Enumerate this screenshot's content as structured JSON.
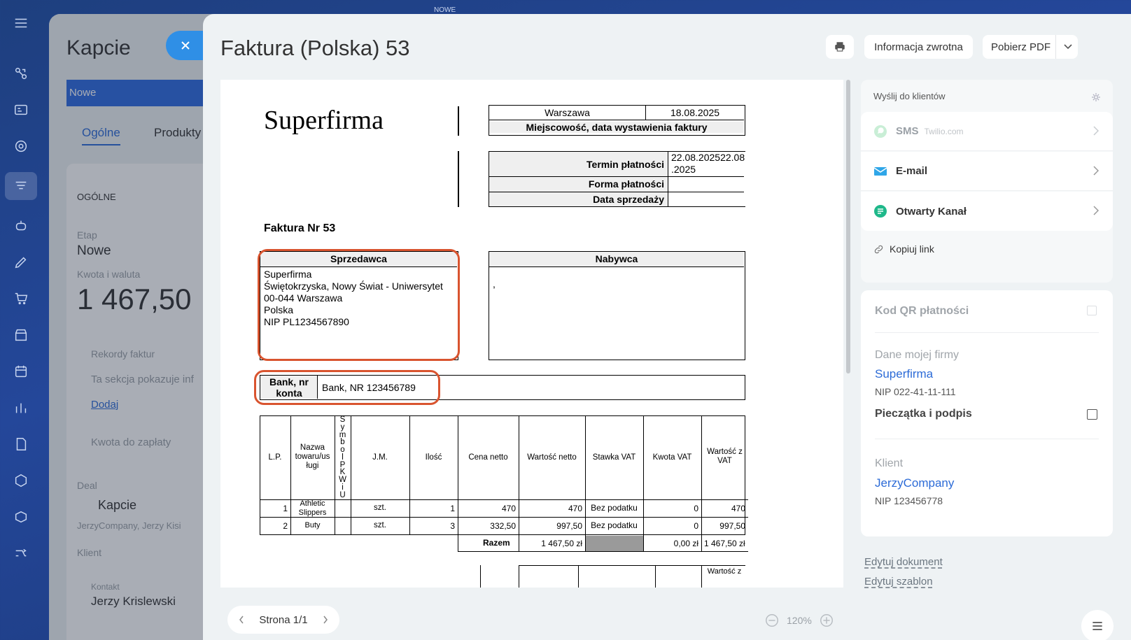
{
  "background": {
    "title": "Kapcie",
    "stage_bar": "Nowe",
    "tab_general": "Ogólne",
    "tab_products": "Produkty",
    "section": "OGÓLNE",
    "stage_label": "Etap",
    "stage_value": "Nowe",
    "amount_label": "Kwota i waluta",
    "amount_value": "1 467,50",
    "invoices_label": "Rekordy faktur",
    "invoices_info": "Ta sekcja pokazuje inf",
    "add_link": "Dodaj",
    "to_pay_label": "Kwota do zapłaty",
    "deal_label": "Deal",
    "deal_value": "Kapcie",
    "deal_sub": "JerzyCompany, Jerzy Kisi",
    "client_label": "Klient",
    "contact_label": "Kontakt",
    "contact_value": "Jerzy Krislewski",
    "top_badge": "NOWE"
  },
  "header": {
    "title": "Faktura (Polska) 53",
    "feedback": "Informacja zwrotna",
    "download_pdf": "Pobierz PDF"
  },
  "invoice": {
    "company": "Superfirma",
    "city": "Warszawa",
    "date": "18.08.2025",
    "place_date_label": "Miejscowość, data wystawienia faktury",
    "due_label": "Termin płatności",
    "due_value_1": "22.08.202522.08",
    "due_value_2": ".2025",
    "payment_form_label": "Forma płatności",
    "sale_date_label": "Data sprzedaży",
    "number": "Faktura Nr 53",
    "seller_label": "Sprzedawca",
    "seller_lines": [
      "Superfirma",
      "Świętokrzyska, Nowy Świat - Uniwersytet",
      "00-044 Warszawa",
      "Polska",
      "NIP PL1234567890"
    ],
    "buyer_label": "Nabywca",
    "buyer_text": ",",
    "bank_label_1": "Bank, nr",
    "bank_label_2": "konta",
    "bank_value": "Bank, NR 123456789",
    "columns": {
      "lp": "L.P.",
      "name_1": "Nazwa",
      "name_2": "towaru/us",
      "name_3": "ługi",
      "pkwiu": [
        "S",
        "y",
        "m",
        "b",
        "o",
        "l",
        "P",
        "K",
        "W",
        "i",
        "U"
      ],
      "unit": "J.M.",
      "qty": "Ilość",
      "price": "Cena netto",
      "net_value": "Wartość netto",
      "vat_rate": "Stawka VAT",
      "vat_amount": "Kwota VAT",
      "gross_1": "Wartość z",
      "gross_2": "VAT"
    },
    "rows": [
      {
        "lp": "1",
        "name_1": "Athletic",
        "name_2": "Slippers",
        "unit": "szt.",
        "qty": "1",
        "price": "470",
        "net": "470",
        "vat_rate": "Bez podatku",
        "vat": "0",
        "gross": "470"
      },
      {
        "lp": "2",
        "name_1": "Buty",
        "name_2": "",
        "unit": "szt.",
        "qty": "3",
        "price": "332,50",
        "net": "997,50",
        "vat_rate": "Bez podatku",
        "vat": "0",
        "gross": "997,50"
      }
    ],
    "total_label": "Razem",
    "total_net": "1 467,50 zł",
    "total_vat": "0,00 zł",
    "total_gross": "1 467,50 zł",
    "next_header": "Wartość z"
  },
  "pager": {
    "label": "Strona 1/1",
    "zoom": "120%"
  },
  "right_panel": {
    "send_title": "Wyślij do klientów",
    "sms": "SMS",
    "sms_provider": "Twilio.com",
    "email": "E-mail",
    "open_channel": "Otwarty Kanał",
    "copy_link": "Kopiuj link",
    "qr_label": "Kod QR płatności",
    "my_company_label": "Dane mojej firmy",
    "my_company": "Superfirma",
    "my_company_nip": "NIP 022-41-11-111",
    "stamp_label": "Pieczątka i podpis",
    "client_label": "Klient",
    "client": "JerzyCompany",
    "client_nip": "NIP 123456778",
    "edit_document": "Edytuj dokument",
    "edit_template": "Edytuj szablon"
  },
  "colors": {
    "accent": "#2c6bd7",
    "highlight": "#d9542f",
    "whatsapp": "#25d366",
    "email": "#2fa6e8",
    "openchannel": "#1fb88a"
  }
}
